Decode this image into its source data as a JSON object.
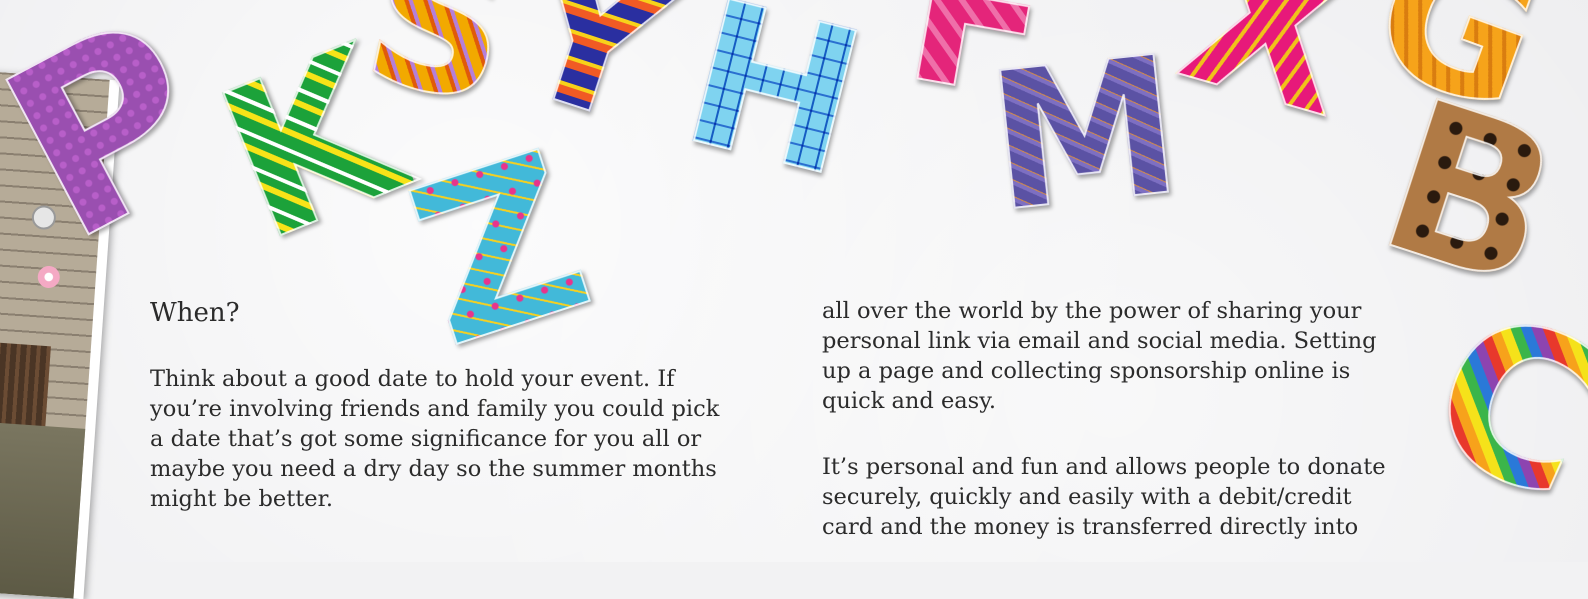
{
  "left_column": {
    "heading": "When?",
    "paragraph": "Think about a good date to hold your event.  If\nyou’re involving friends and family you could pick\na date that’s got some significance for you all or\nmaybe you need a dry day so the summer months\nmight be better."
  },
  "right_column": {
    "paragraph_1": "all over the world by the power of sharing your\npersonal link via email and social media. Setting\nup a page and collecting sponsorship online is\nquick and easy.",
    "paragraph_2": "It’s personal and fun and allows people to donate\nsecurely, quickly and easily with a debit/credit\ncard and the money is transferred directly into"
  },
  "decorations": {
    "letters": [
      "P",
      "K",
      "S",
      "Z",
      "Y",
      "H",
      "F",
      "M",
      "X",
      "G",
      "B",
      "C"
    ]
  },
  "colors": {
    "background": "#eeeef0",
    "text": "#2b2b2b"
  }
}
